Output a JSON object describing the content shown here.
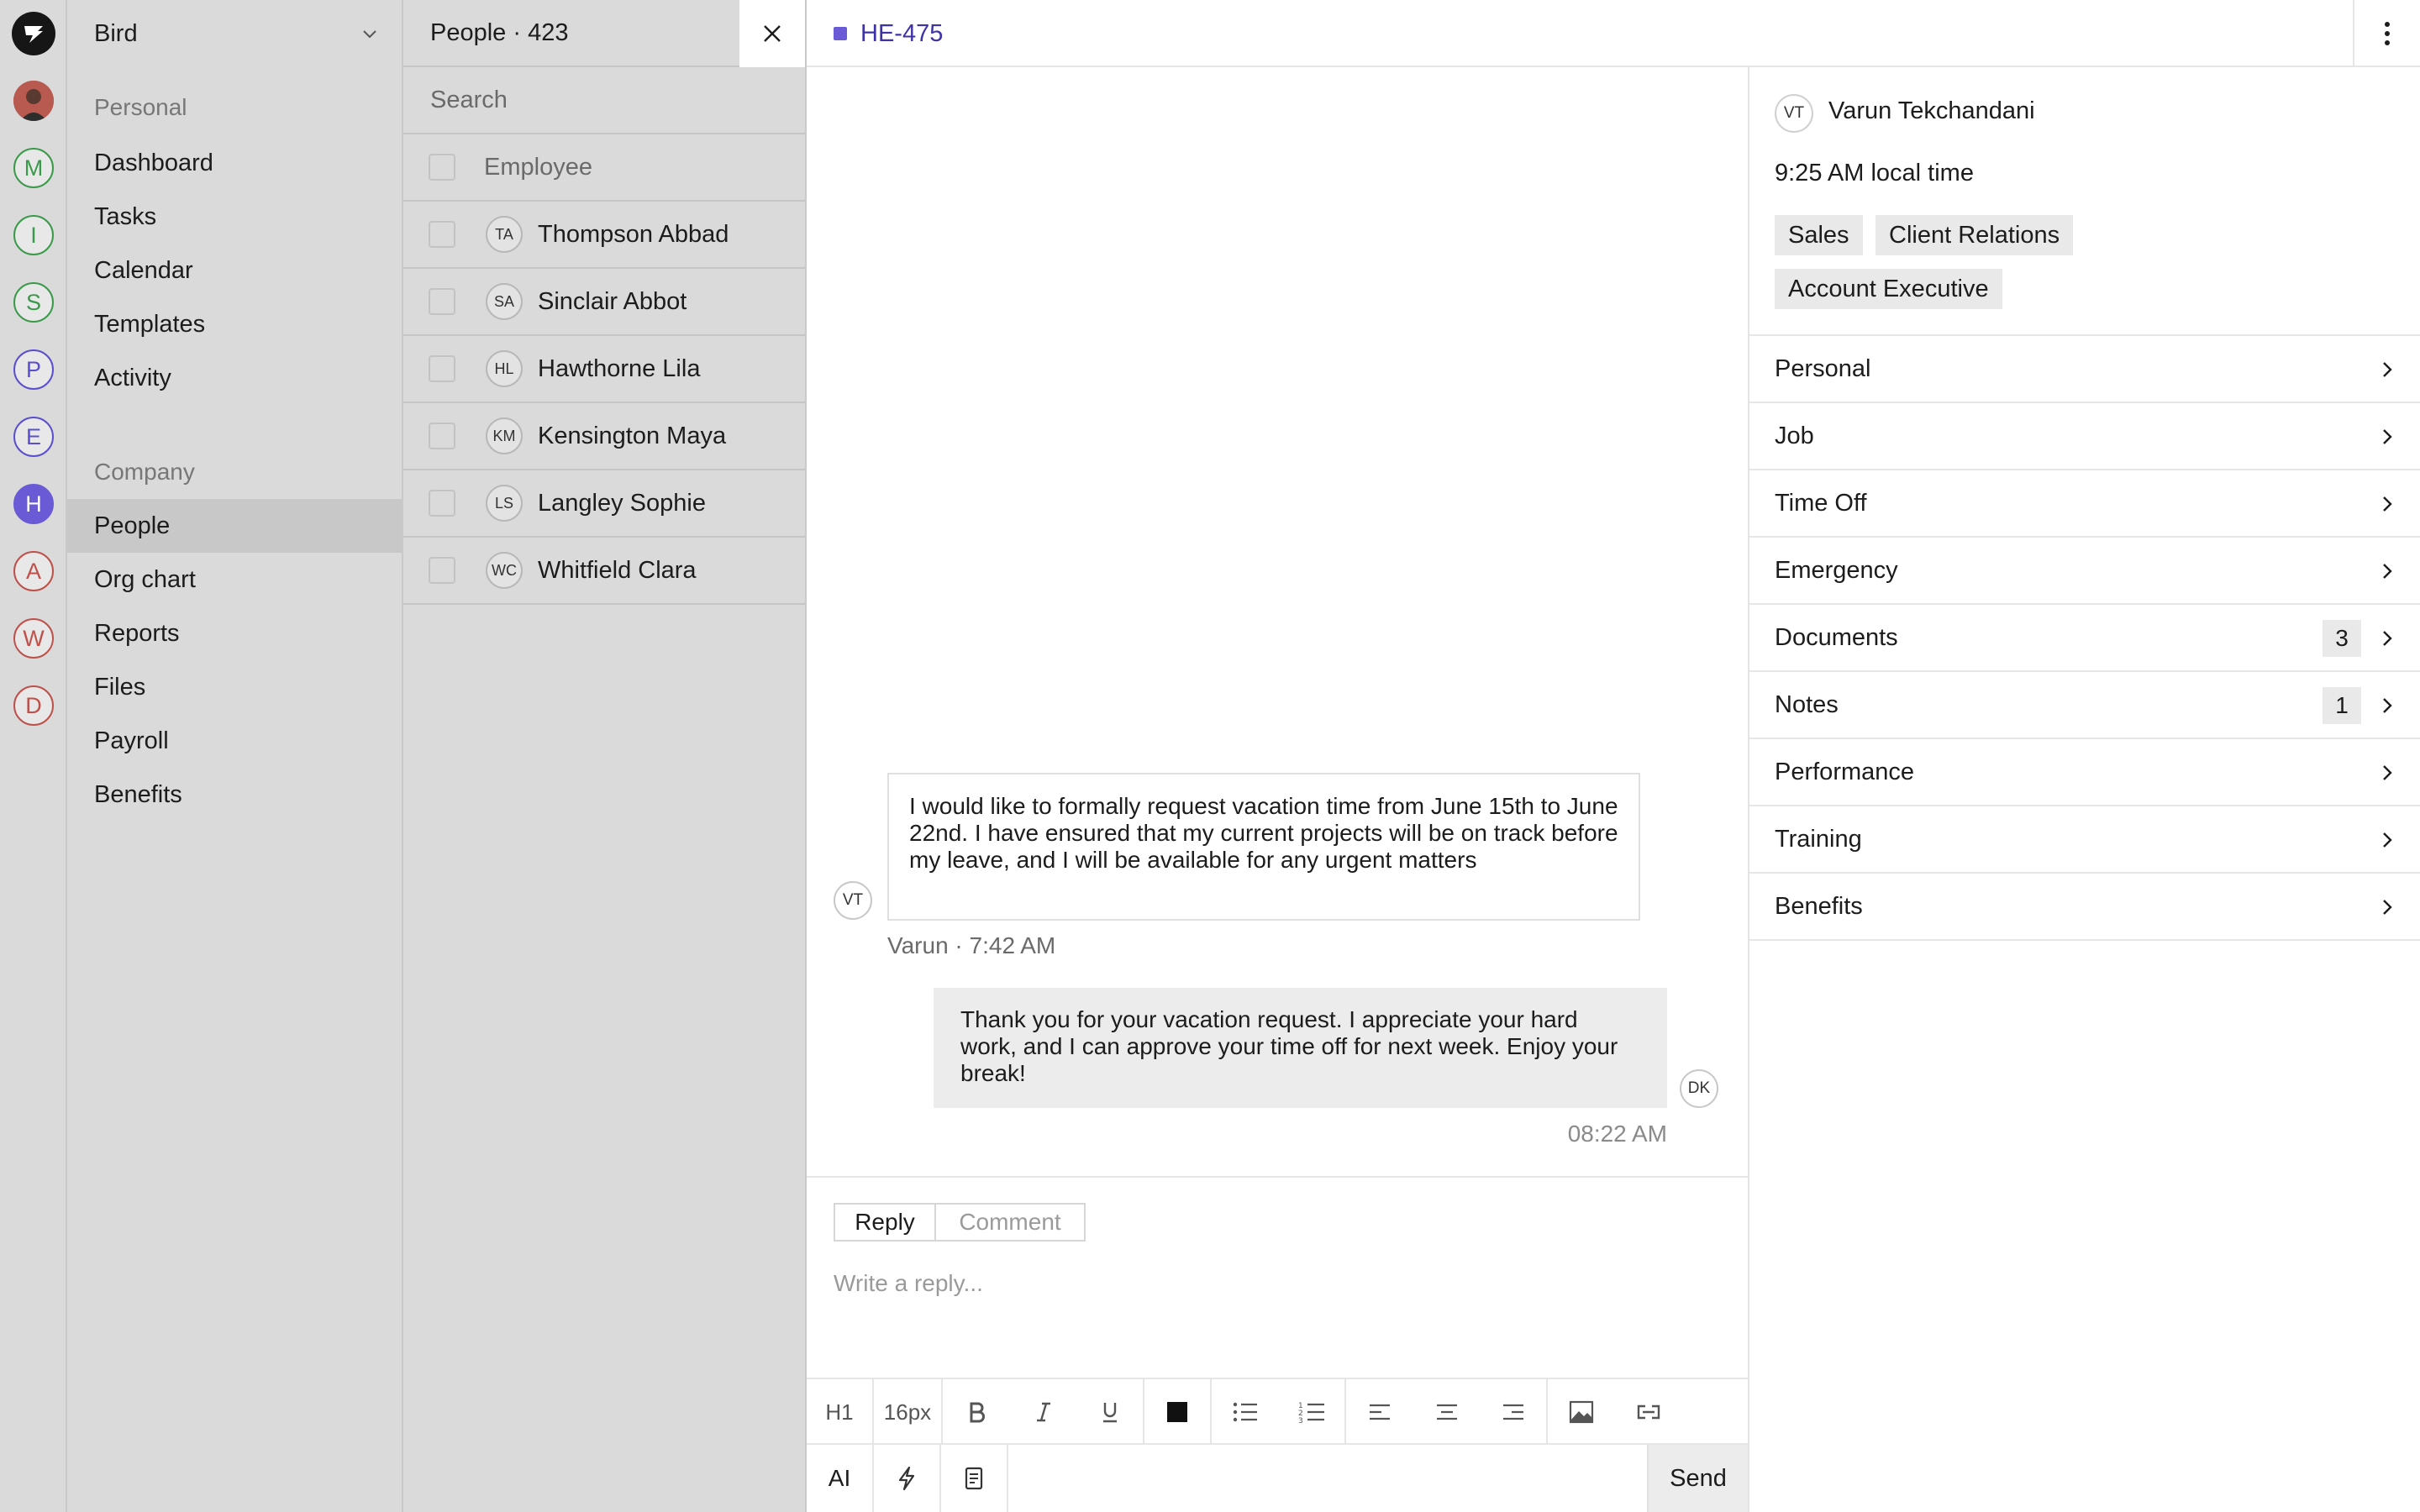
{
  "rail": {
    "apps": [
      {
        "letter": "M",
        "color": "#3a9a4a"
      },
      {
        "letter": "I",
        "color": "#3a9a4a"
      },
      {
        "letter": "S",
        "color": "#3a9a4a"
      },
      {
        "letter": "P",
        "color": "#5a4fd0"
      },
      {
        "letter": "E",
        "color": "#5a4fd0"
      },
      {
        "letter": "H",
        "color": "#6a5ad6",
        "active": true
      },
      {
        "letter": "A",
        "color": "#c0504a"
      },
      {
        "letter": "W",
        "color": "#c0504a"
      },
      {
        "letter": "D",
        "color": "#c0504a"
      }
    ]
  },
  "sidebar": {
    "workspace": "Bird",
    "personal_label": "Personal",
    "personal_items": [
      "Dashboard",
      "Tasks",
      "Calendar",
      "Templates",
      "Activity"
    ],
    "company_label": "Company",
    "company_items": [
      "People",
      "Org chart",
      "Reports",
      "Files",
      "Payroll",
      "Benefits"
    ],
    "active_item": "People"
  },
  "people_list": {
    "title": "People · 423",
    "search_placeholder": "Search",
    "column_header": "Employee",
    "rows": [
      {
        "initials": "TA",
        "name": "Thompson Abbad"
      },
      {
        "initials": "SA",
        "name": "Sinclair Abbot"
      },
      {
        "initials": "HL",
        "name": "Hawthorne Lila"
      },
      {
        "initials": "KM",
        "name": "Kensington Maya"
      },
      {
        "initials": "LS",
        "name": "Langley Sophie"
      },
      {
        "initials": "WC",
        "name": "Whitfield Clara"
      }
    ]
  },
  "ticket": {
    "id": "HE-475",
    "accent": "#6a5ad6"
  },
  "conversation": {
    "incoming": {
      "avatar": "VT",
      "text": "I would like to formally request vacation time from June 15th to June 22nd. I have ensured that my current projects will be on track before my leave, and I will be available for any urgent matters",
      "meta": "Varun · 7:42 AM"
    },
    "outgoing": {
      "avatar": "DK",
      "text": "Thank you for your vacation request. I appreciate your hard work, and I can approve your time off for next week. Enjoy your break!",
      "time": "08:22 AM"
    }
  },
  "composer": {
    "tab_reply": "Reply",
    "tab_comment": "Comment",
    "placeholder": "Write a reply...",
    "heading": "H1",
    "font_size": "16px",
    "ai_label": "AI",
    "send_label": "Send"
  },
  "profile": {
    "initials": "VT",
    "name": "Varun Tekchandani",
    "local_time": "9:25 AM local time",
    "tags": [
      "Sales",
      "Client Relations",
      "Account Executive"
    ],
    "sections": [
      {
        "label": "Personal"
      },
      {
        "label": "Job"
      },
      {
        "label": "Time Off"
      },
      {
        "label": "Emergency"
      },
      {
        "label": "Documents",
        "count": "3"
      },
      {
        "label": "Notes",
        "count": "1"
      },
      {
        "label": "Performance"
      },
      {
        "label": "Training"
      },
      {
        "label": "Benefits"
      }
    ]
  }
}
